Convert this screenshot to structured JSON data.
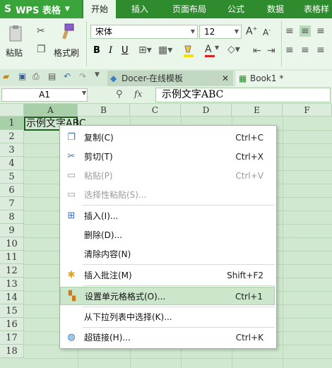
{
  "app": {
    "title": "WPS 表格"
  },
  "ribbon": {
    "tabs": [
      "开始",
      "插入",
      "页面布局",
      "公式",
      "数据",
      "表格样"
    ],
    "active": "开始"
  },
  "toolbar": {
    "paste": "粘贴",
    "format_painter": "格式刷",
    "font": "宋体",
    "size": "12",
    "bold": "B",
    "italic": "I",
    "underline": "U",
    "grow": "A",
    "shrink": "A",
    "font_color": "A"
  },
  "docs": {
    "docer": "Docer-在线模板",
    "book": "Book1 *"
  },
  "formula": {
    "cell": "A1",
    "fx": "fx",
    "value": "示例文字ABC"
  },
  "grid": {
    "columns": [
      "A",
      "B",
      "C",
      "D",
      "E",
      "F"
    ],
    "rows": [
      "1",
      "2",
      "3",
      "4",
      "5",
      "6",
      "7",
      "8",
      "9",
      "10",
      "11",
      "12",
      "13",
      "14",
      "15",
      "16",
      "17",
      "18"
    ],
    "a1": "示例文字ABC"
  },
  "menu": {
    "copy": {
      "label": "复制(C)",
      "shortcut": "Ctrl+C"
    },
    "cut": {
      "label": "剪切(T)",
      "shortcut": "Ctrl+X"
    },
    "paste": {
      "label": "粘贴(P)",
      "shortcut": "Ctrl+V"
    },
    "paste_special": {
      "label": "选择性粘贴(S)..."
    },
    "insert": {
      "label": "插入(I)..."
    },
    "delete": {
      "label": "删除(D)..."
    },
    "clear": {
      "label": "清除内容(N)"
    },
    "comment": {
      "label": "插入批注(M)",
      "shortcut": "Shift+F2"
    },
    "format_cells": {
      "label": "设置单元格格式(O)...",
      "shortcut": "Ctrl+1"
    },
    "pick_list": {
      "label": "从下拉列表中选择(K)..."
    },
    "hyperlink": {
      "label": "超链接(H)...",
      "shortcut": "Ctrl+K"
    }
  },
  "colors": {
    "ribbon": "#2e8b2e",
    "highlight": "#cce6cc",
    "grid": "#cfe8cf"
  }
}
